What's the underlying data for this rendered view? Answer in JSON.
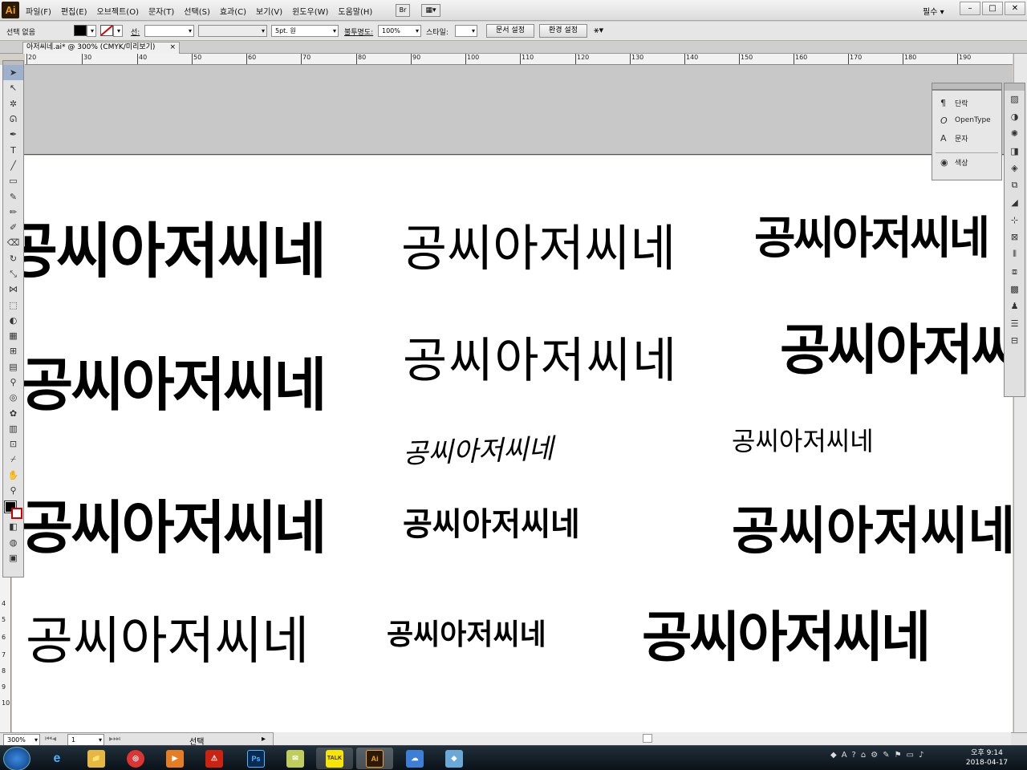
{
  "menubar": {
    "logo": "Ai",
    "items": [
      "파일(F)",
      "편집(E)",
      "오브젝트(O)",
      "문자(T)",
      "선택(S)",
      "효과(C)",
      "보기(V)",
      "윈도우(W)",
      "도움말(H)"
    ],
    "bridge": "Br",
    "workspace": "필수 ▾",
    "window_buttons": [
      "–",
      "□",
      "✕"
    ]
  },
  "control": {
    "selection": "선택 없음",
    "stroke_label": "선:",
    "brush": "5pt. 원",
    "opacity_label": "불투명도:",
    "opacity": "100%",
    "style_label": "스타일:",
    "doc_setup": "문서 설정",
    "prefs": "환경 설정"
  },
  "tab": {
    "title": "아저씨네.ai* @ 300% (CMYK/미리보기)",
    "close": "×"
  },
  "ruler": {
    "h": [
      "20",
      "30",
      "40",
      "50",
      "60",
      "70",
      "80",
      "90",
      "100",
      "110",
      "120",
      "130",
      "140",
      "150",
      "160",
      "170",
      "180",
      "190"
    ],
    "v": [
      "4",
      "5",
      "6",
      "7",
      "8",
      "9",
      "10"
    ]
  },
  "artboard": {
    "samples": [
      {
        "text": "공씨아저씨네"
      },
      {
        "text": "공씨아저씨네"
      },
      {
        "text": "공씨아저씨네"
      },
      {
        "text": "공씨아저씨네"
      },
      {
        "text": "공씨아저씨네"
      },
      {
        "text": "공씨아저씨네"
      },
      {
        "text": "공씨아저씨네"
      },
      {
        "text": "공씨아저씨네"
      },
      {
        "text": "공씨아저씨네"
      },
      {
        "text": "공씨아저씨네"
      },
      {
        "text": "공씨아저씨네"
      },
      {
        "text": "공씨아저씨네"
      },
      {
        "text": "공씨아저씨네"
      },
      {
        "text": "공씨아저씨네"
      }
    ]
  },
  "panels": {
    "char_items": [
      {
        "icon": "¶",
        "label": "단락"
      },
      {
        "icon": "O",
        "label": "OpenType"
      },
      {
        "icon": "A",
        "label": "문자"
      },
      {
        "icon": "◉",
        "label": "색상"
      }
    ]
  },
  "status": {
    "zoom": "300%",
    "page": "1",
    "mode": "선택"
  },
  "taskbar": {
    "apps": [
      "e",
      "📁",
      "◎",
      "▶",
      "⚠",
      "Ps",
      "✉",
      "TALK",
      "Ai",
      "☁",
      "◆"
    ],
    "time": "오후 9:14",
    "date": "2018-04-17"
  }
}
